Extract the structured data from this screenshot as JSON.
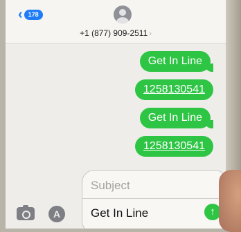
{
  "header": {
    "back_badge": "178",
    "contact_number": "+1 (877) 909-2511"
  },
  "messages": [
    {
      "text": "Get In Line",
      "link": false
    },
    {
      "text": "1258130541",
      "link": true
    },
    {
      "text": "Get In Line",
      "link": false
    },
    {
      "text": "1258130541",
      "link": true
    }
  ],
  "compose": {
    "subject_placeholder": "Subject",
    "message_text": "Get In Line"
  },
  "icons": {
    "back": "chevron-left-icon",
    "avatar": "contact-avatar-icon",
    "camera": "camera-icon",
    "apps": "app-store-icon",
    "send": "send-arrow-icon"
  },
  "colors": {
    "bubble": "#2ec544",
    "accent": "#1f7cf6"
  }
}
